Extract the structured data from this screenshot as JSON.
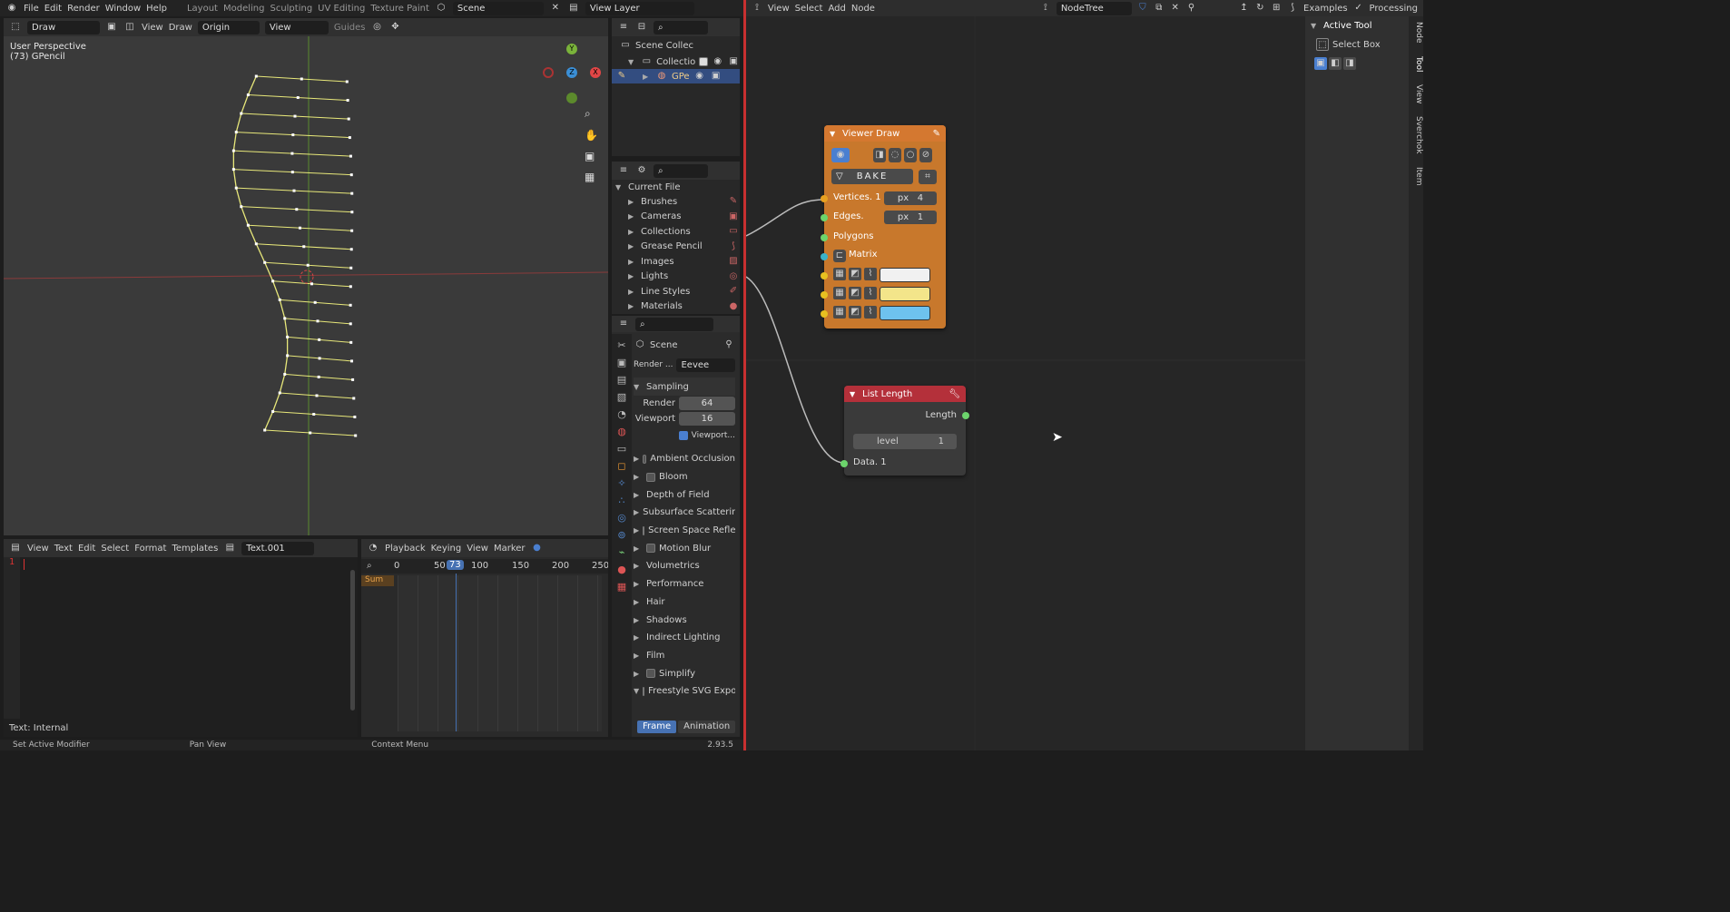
{
  "topbar": {
    "menus": [
      "File",
      "Edit",
      "Render",
      "Window",
      "Help"
    ],
    "workspaces": [
      "Layout",
      "Modeling",
      "Sculpting",
      "UV Editing",
      "Texture Paint"
    ],
    "scene": "Scene",
    "view_layer": "View Layer"
  },
  "viewport": {
    "mode": "Draw",
    "tool": "Draw",
    "menus": [
      "View",
      "Draw"
    ],
    "origin": "Origin",
    "view": "View",
    "guides": "Guides",
    "info1": "User Perspective",
    "info2": "(73) GPencil",
    "gizmo": {
      "y": "Y",
      "z": "Z",
      "x": "X"
    }
  },
  "outliner": {
    "scene_collection": "Scene Collec",
    "collection": "Collectio",
    "gpencil": "GPe"
  },
  "blendfile": {
    "root": "Current File",
    "items": [
      "Brushes",
      "Cameras",
      "Collections",
      "Grease Pencil",
      "Images",
      "Lights",
      "Line Styles",
      "Materials"
    ]
  },
  "properties": {
    "scene": "Scene",
    "render_label": "Render ...",
    "engine": "Eevee",
    "sampling": "Sampling",
    "render": "Render",
    "render_val": "64",
    "viewport": "Viewport",
    "viewport_val": "16",
    "viewport_denoise": "Viewport...",
    "panels": [
      "Ambient Occlusion",
      "Bloom",
      "Depth of Field",
      "Subsurface Scattering",
      "Screen Space Refle",
      "Motion Blur",
      "Volumetrics",
      "Performance",
      "Hair",
      "Shadows",
      "Indirect Lighting",
      "Film",
      "Simplify",
      "Freestyle SVG Expo"
    ],
    "frame": "Frame",
    "animation": "Animation"
  },
  "texteditor": {
    "menus": [
      "View",
      "Text",
      "Edit",
      "Select",
      "Format",
      "Templates"
    ],
    "name": "Text.001",
    "line": "1",
    "footer": "Text: Internal"
  },
  "timeline": {
    "menus": [
      "Playback",
      "Keying",
      "View",
      "Marker"
    ],
    "ticks": [
      "0",
      "50",
      "100",
      "150",
      "200",
      "250"
    ],
    "current": "73",
    "summary": "Sum"
  },
  "nodeeditor": {
    "menus": [
      "View",
      "Select",
      "Add",
      "Node"
    ],
    "tree": "NodeTree",
    "examples": "Examples",
    "processing": "Processing"
  },
  "sidebar": {
    "panel": "Active Tool",
    "tool": "Select Box",
    "tabs": [
      "Node",
      "Tool",
      "View",
      "Sverchok",
      "Item"
    ]
  },
  "viewer_draw": {
    "title": "Viewer Draw",
    "bake": "BAKE",
    "vertices": "Vertices. 1",
    "vsize": "4",
    "edges": "Edges.",
    "esize": "1",
    "polygons": "Polygons",
    "matrix": "Matrix",
    "px": "px",
    "colors": [
      "#f1f1f1",
      "#f3e58a",
      "#6ec2ee"
    ]
  },
  "list_length": {
    "title": "List Length",
    "length": "Length",
    "level": "level",
    "level_val": "1",
    "data": "Data. 1"
  },
  "statusbar": {
    "left": "Set Active Modifier",
    "mid": "Pan View",
    "right": "Context Menu",
    "version": "2.93.5"
  }
}
